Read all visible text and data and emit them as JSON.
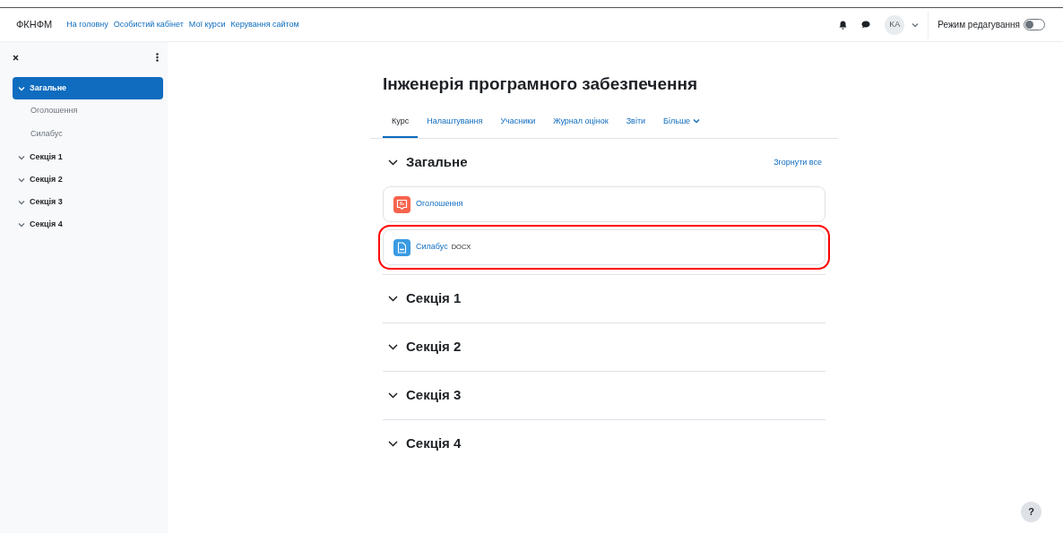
{
  "navbar": {
    "brand": "ФКНФМ",
    "links": [
      "На головну",
      "Особистий кабінет",
      "Мої курси",
      "Керування сайтом"
    ],
    "avatar": "KA",
    "edit_mode": {
      "label": "Режим редагування",
      "on": false
    }
  },
  "drawer": {
    "items": [
      {
        "label": "Загальне",
        "selected": true,
        "children": [
          {
            "label": "Оголошення",
            "selected": false
          },
          {
            "label": "Силабус",
            "selected": false
          }
        ]
      },
      {
        "label": "Секція 1",
        "selected": false
      },
      {
        "label": "Секція 2",
        "selected": false
      },
      {
        "label": "Секція 3",
        "selected": false
      },
      {
        "label": "Секція 4",
        "selected": false
      }
    ]
  },
  "course": {
    "title": "Інженерія програмного забезпечення",
    "tabs": [
      {
        "label": "Курс",
        "selected": true
      },
      {
        "label": "Налаштування",
        "selected": false
      },
      {
        "label": "Учасники",
        "selected": false
      },
      {
        "label": "Журнал оцінок",
        "selected": false
      },
      {
        "label": "Звіти",
        "selected": false
      },
      {
        "label": "Більше",
        "selected": false
      }
    ],
    "collapse_all": "Згорнути все",
    "sections": [
      {
        "title": "Загальне",
        "activities": [
          {
            "kind": "forum",
            "name": "Оголошення",
            "highlighted": false
          },
          {
            "kind": "file",
            "name": "Силабус",
            "filetype": "DOCX",
            "highlighted": true
          }
        ]
      },
      {
        "title": "Секція 1"
      },
      {
        "title": "Секція 2"
      },
      {
        "title": "Секція 3"
      },
      {
        "title": "Секція 4"
      }
    ]
  },
  "help": "?"
}
